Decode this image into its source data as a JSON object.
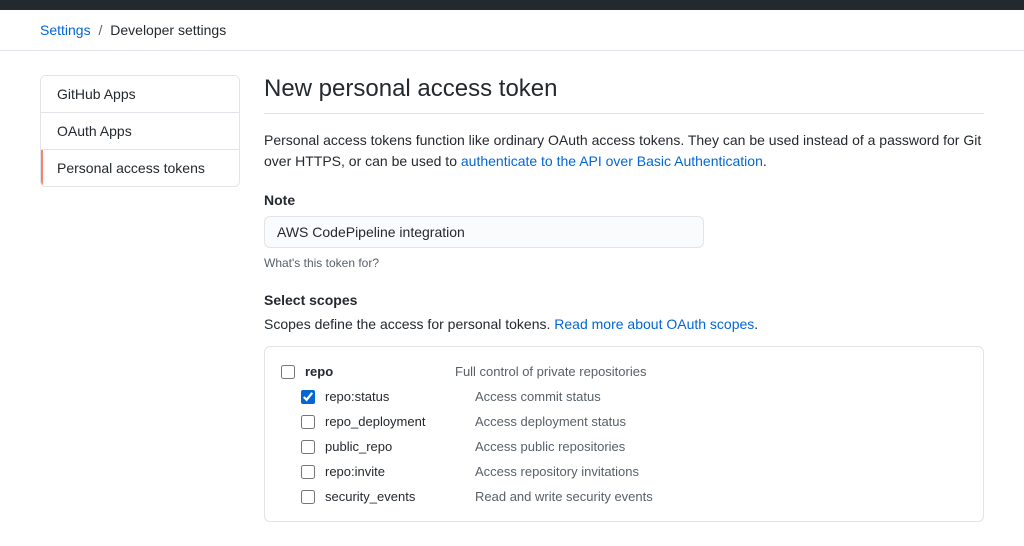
{
  "breadcrumb": {
    "root": "Settings",
    "sep": "/",
    "current": "Developer settings"
  },
  "sidebar": {
    "items": [
      {
        "label": "GitHub Apps",
        "active": false
      },
      {
        "label": "OAuth Apps",
        "active": false
      },
      {
        "label": "Personal access tokens",
        "active": true
      }
    ]
  },
  "page": {
    "title": "New personal access token",
    "description_pre": "Personal access tokens function like ordinary OAuth access tokens. They can be used instead of a password for Git over HTTPS, or can be used to ",
    "description_link": "authenticate to the API over Basic Authentication",
    "description_post": "."
  },
  "note": {
    "label": "Note",
    "value": "AWS CodePipeline integration",
    "help": "What's this token for?"
  },
  "scopes": {
    "heading": "Select scopes",
    "desc_pre": "Scopes define the access for personal tokens. ",
    "desc_link": "Read more about OAuth scopes",
    "desc_post": ".",
    "items": [
      {
        "name": "repo",
        "desc": "Full control of private repositories",
        "checked": false,
        "bold": true,
        "child": false
      },
      {
        "name": "repo:status",
        "desc": "Access commit status",
        "checked": true,
        "bold": false,
        "child": true
      },
      {
        "name": "repo_deployment",
        "desc": "Access deployment status",
        "checked": false,
        "bold": false,
        "child": true
      },
      {
        "name": "public_repo",
        "desc": "Access public repositories",
        "checked": false,
        "bold": false,
        "child": true
      },
      {
        "name": "repo:invite",
        "desc": "Access repository invitations",
        "checked": false,
        "bold": false,
        "child": true
      },
      {
        "name": "security_events",
        "desc": "Read and write security events",
        "checked": false,
        "bold": false,
        "child": true
      }
    ]
  }
}
